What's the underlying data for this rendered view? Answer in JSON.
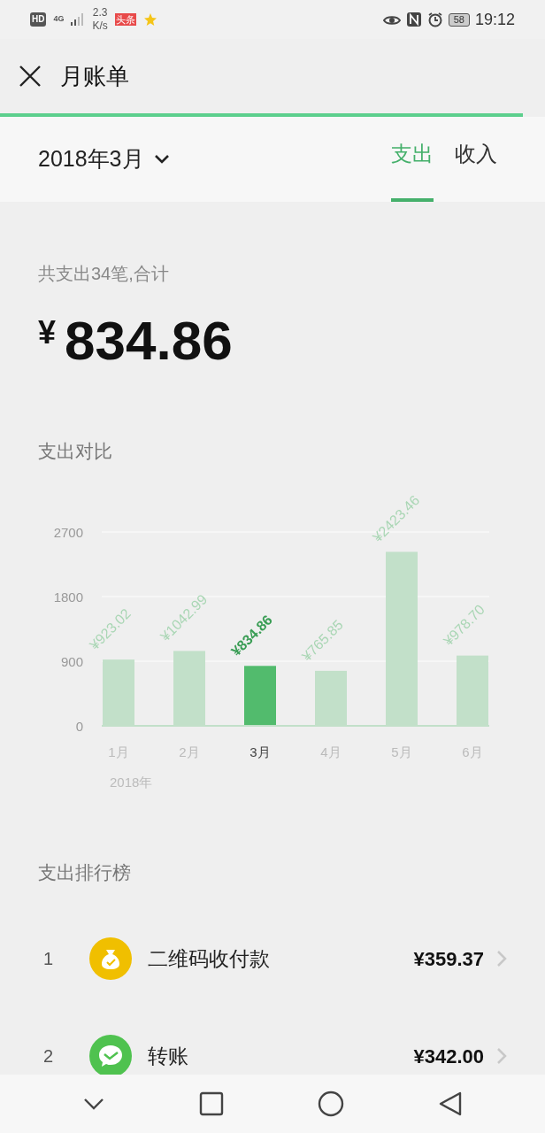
{
  "status_bar": {
    "hd": "HD",
    "network": "4G",
    "speed_value": "2.3",
    "speed_unit": "K/s",
    "news_badge": "头条",
    "battery": "58",
    "time": "19:12"
  },
  "header": {
    "title": "月账单"
  },
  "page_progress": {
    "level": 0.96
  },
  "month_bar": {
    "month": "2018年3月",
    "tabs": [
      {
        "label": "支出",
        "selected": true
      },
      {
        "label": "收入",
        "selected": false
      }
    ]
  },
  "summary": {
    "caption": "共支出34笔,合计",
    "currency": "¥",
    "amount": "834.86"
  },
  "comparison": {
    "title": "支出对比",
    "year_label": "2018年",
    "bars": [
      {
        "selected": false,
        "color": "#c2e0c9"
      },
      {
        "selected": false,
        "color": "#c2e0c9"
      },
      {
        "selected": true,
        "color": "#52bb6d"
      },
      {
        "selected": false,
        "color": "#c2e0c9"
      },
      {
        "selected": false,
        "color": "#c2e0c9"
      },
      {
        "selected": false,
        "color": "#c2e0c9"
      }
    ],
    "chart_data": {
      "type": "bar",
      "categories": [
        "1月",
        "2月",
        "3月",
        "4月",
        "5月",
        "6月"
      ],
      "values": [
        923.02,
        1042.99,
        834.86,
        765.85,
        2423.46,
        978.7
      ],
      "ylim": [
        0,
        2700
      ],
      "yticks": [
        0,
        900,
        1800,
        2700
      ],
      "value_labels": [
        "¥923.02",
        "¥1042.99",
        "¥834.86",
        "¥765.85",
        "¥2423.46",
        "¥978.70"
      ]
    }
  },
  "ranking": {
    "title": "支出排行榜",
    "rows": [
      {
        "rank": "1",
        "kind": "qr-pay",
        "name": "二维码收付款",
        "amount": "¥359.37"
      },
      {
        "rank": "2",
        "kind": "transfer",
        "name": "转账",
        "amount": "¥342.00"
      }
    ]
  }
}
